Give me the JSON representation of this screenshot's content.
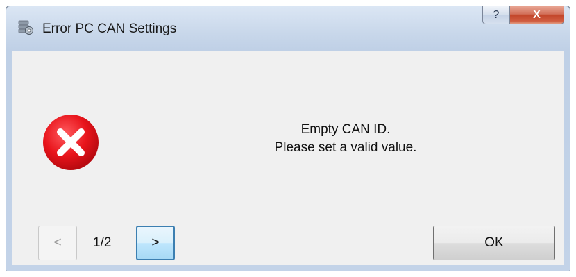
{
  "window": {
    "title": "Error PC CAN Settings",
    "title_icon": "settings-app-icon"
  },
  "caption_buttons": {
    "help_label": "?",
    "close_label": "X"
  },
  "message": {
    "icon": "error-icon",
    "line1": "Empty CAN ID.",
    "line2": "Please set a valid value."
  },
  "navigation": {
    "prev_label": "<",
    "page_indicator": "1/2",
    "next_label": ">"
  },
  "buttons": {
    "ok_label": "OK"
  },
  "colors": {
    "error_red": "#e8141b",
    "close_button": "#c7472b",
    "focus_border": "#3c7fb1",
    "dialog_background": "#f0f0f0"
  }
}
